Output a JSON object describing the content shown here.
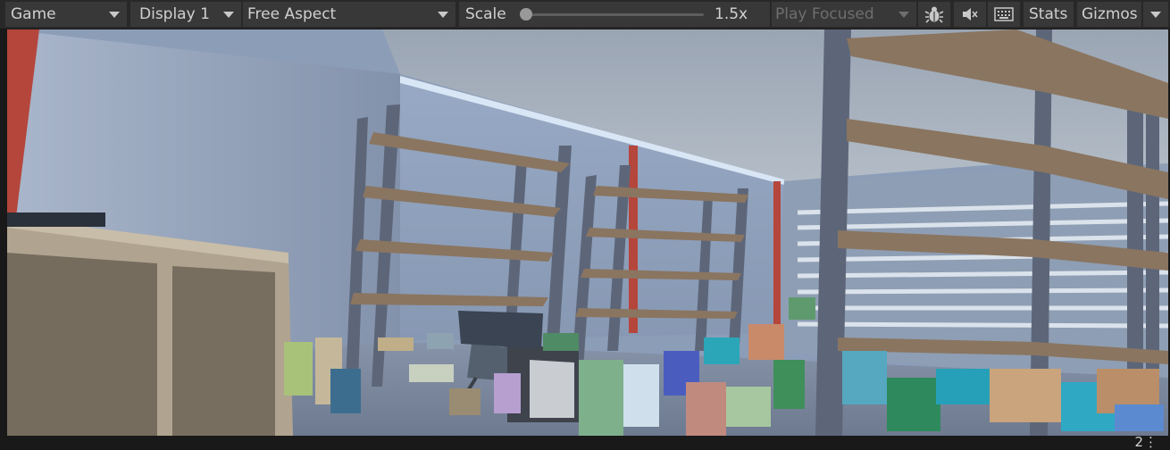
{
  "toolbar": {
    "game_view": "Game",
    "display": "Display 1",
    "aspect": "Free Aspect",
    "scale_label": "Scale",
    "scale_value": "1.5x",
    "scale_fraction": 0.0,
    "play_mode": "Play Focused",
    "stats_label": "Stats",
    "gizmos_label": "Gizmos",
    "icons": [
      "bug-icon",
      "mute-audio-icon",
      "keyboard-icon"
    ]
  },
  "status_bar": {
    "indicator": "2",
    "menu": "⋮"
  },
  "colors": {
    "toolbar_bg": "#282828",
    "button_bg": "#383838",
    "wall": "#8c9db8",
    "floor": "#7f8aa0",
    "shelf_frame": "#5d6679",
    "shelf_board": "#8a7560",
    "red_pipe": "#b5463b"
  }
}
